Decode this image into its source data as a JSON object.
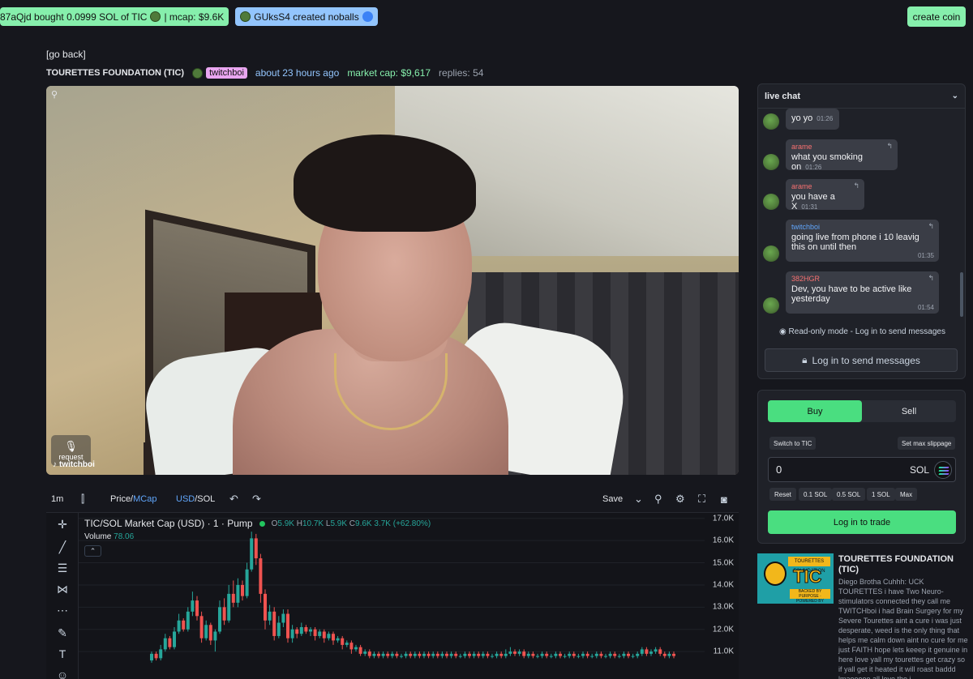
{
  "ticker": {
    "trade_text": "87aQjd bought 0.0999 SOL of TIC",
    "trade_mcap": "| mcap: $9.6K",
    "created_text": "GUksS4 created noballs",
    "create_coin": "create coin"
  },
  "header": {
    "go_back": "[go back]",
    "coin_name": "TOURETTES FOUNDATION (TIC)",
    "creator": "twitchboi",
    "age": "about 23 hours ago",
    "market_cap": "market cap: $9,617",
    "replies": "replies: 54"
  },
  "video": {
    "request_label": "request",
    "streamer": "twitchboi"
  },
  "chart_toolbar": {
    "interval": "1m",
    "price_label": "Price/",
    "mcap_label": "MCap",
    "usd_label": "USD",
    "sol_label": "/SOL",
    "save": "Save"
  },
  "chart_data": {
    "type": "candlestick",
    "title": "TIC/SOL Market Cap (USD) · 1 · Pump",
    "ohlc": {
      "o": "5.9K",
      "h": "10.7K",
      "l": "5.9K",
      "c": "9.6K",
      "change": "3.7K (+62.80%)"
    },
    "volume_label": "Volume",
    "volume_value": "78.06",
    "y_ticks": [
      "17.0K",
      "16.0K",
      "15.0K",
      "14.0K",
      "13.0K",
      "12.0K",
      "11.0K"
    ],
    "ylim": [
      10700,
      17100
    ],
    "colors": {
      "up": "#26a69a",
      "down": "#ef5350"
    },
    "candles": [
      {
        "o": 10.6,
        "c": 10.9,
        "h": 11.0,
        "l": 10.5
      },
      {
        "o": 10.9,
        "c": 10.7,
        "h": 11.0,
        "l": 10.6
      },
      {
        "o": 10.7,
        "c": 11.1,
        "h": 11.3,
        "l": 10.6
      },
      {
        "o": 11.1,
        "c": 11.6,
        "h": 11.8,
        "l": 11.0
      },
      {
        "o": 11.6,
        "c": 11.2,
        "h": 11.7,
        "l": 11.1
      },
      {
        "o": 11.2,
        "c": 11.9,
        "h": 12.1,
        "l": 11.1
      },
      {
        "o": 11.9,
        "c": 12.4,
        "h": 12.7,
        "l": 11.8
      },
      {
        "o": 12.4,
        "c": 12.0,
        "h": 12.5,
        "l": 11.9
      },
      {
        "o": 12.0,
        "c": 12.8,
        "h": 13.0,
        "l": 11.9
      },
      {
        "o": 12.8,
        "c": 13.3,
        "h": 13.7,
        "l": 12.6
      },
      {
        "o": 13.3,
        "c": 12.6,
        "h": 13.5,
        "l": 12.4
      },
      {
        "o": 12.6,
        "c": 11.6,
        "h": 12.8,
        "l": 11.4
      },
      {
        "o": 11.6,
        "c": 12.2,
        "h": 12.4,
        "l": 11.5
      },
      {
        "o": 12.2,
        "c": 11.5,
        "h": 12.3,
        "l": 11.3
      },
      {
        "o": 11.5,
        "c": 11.9,
        "h": 12.0,
        "l": 11.0
      },
      {
        "o": 11.9,
        "c": 13.0,
        "h": 13.3,
        "l": 11.8
      },
      {
        "o": 13.0,
        "c": 12.4,
        "h": 13.4,
        "l": 12.2
      },
      {
        "o": 12.4,
        "c": 13.6,
        "h": 14.0,
        "l": 12.3
      },
      {
        "o": 13.6,
        "c": 13.2,
        "h": 14.2,
        "l": 13.0
      },
      {
        "o": 13.2,
        "c": 14.0,
        "h": 14.3,
        "l": 13.0
      },
      {
        "o": 14.0,
        "c": 13.5,
        "h": 14.2,
        "l": 13.3
      },
      {
        "o": 13.5,
        "c": 14.7,
        "h": 15.0,
        "l": 13.4
      },
      {
        "o": 14.7,
        "c": 16.1,
        "h": 16.4,
        "l": 14.6
      },
      {
        "o": 16.1,
        "c": 15.2,
        "h": 16.3,
        "l": 14.9
      },
      {
        "o": 15.2,
        "c": 13.6,
        "h": 15.4,
        "l": 13.2
      },
      {
        "o": 13.6,
        "c": 12.4,
        "h": 13.8,
        "l": 12.0
      },
      {
        "o": 12.4,
        "c": 12.8,
        "h": 13.1,
        "l": 12.2
      },
      {
        "o": 12.8,
        "c": 11.7,
        "h": 13.0,
        "l": 11.5
      },
      {
        "o": 11.7,
        "c": 12.3,
        "h": 12.6,
        "l": 11.6
      },
      {
        "o": 12.3,
        "c": 12.7,
        "h": 12.9,
        "l": 12.1
      },
      {
        "o": 12.7,
        "c": 11.6,
        "h": 12.9,
        "l": 11.4
      },
      {
        "o": 11.6,
        "c": 12.0,
        "h": 12.2,
        "l": 11.4
      },
      {
        "o": 12.0,
        "c": 11.8,
        "h": 12.1,
        "l": 11.6
      },
      {
        "o": 11.8,
        "c": 12.1,
        "h": 12.3,
        "l": 11.7
      },
      {
        "o": 12.1,
        "c": 11.9,
        "h": 12.2,
        "l": 11.8
      },
      {
        "o": 11.9,
        "c": 12.0,
        "h": 12.1,
        "l": 11.7
      },
      {
        "o": 12.0,
        "c": 11.7,
        "h": 12.1,
        "l": 11.5
      },
      {
        "o": 11.7,
        "c": 11.9,
        "h": 12.0,
        "l": 11.6
      },
      {
        "o": 11.9,
        "c": 11.6,
        "h": 12.0,
        "l": 11.4
      },
      {
        "o": 11.6,
        "c": 11.8,
        "h": 11.9,
        "l": 11.5
      },
      {
        "o": 11.8,
        "c": 11.5,
        "h": 11.9,
        "l": 11.3
      },
      {
        "o": 11.5,
        "c": 11.6,
        "h": 11.7,
        "l": 11.4
      },
      {
        "o": 11.6,
        "c": 11.3,
        "h": 11.7,
        "l": 11.1
      },
      {
        "o": 11.3,
        "c": 11.4,
        "h": 11.5,
        "l": 11.2
      },
      {
        "o": 11.4,
        "c": 11.1,
        "h": 11.5,
        "l": 10.9
      },
      {
        "o": 11.1,
        "c": 11.2,
        "h": 11.3,
        "l": 11.0
      },
      {
        "o": 11.2,
        "c": 10.9,
        "h": 11.3,
        "l": 10.8
      },
      {
        "o": 10.9,
        "c": 11.0,
        "h": 11.1,
        "l": 10.8
      },
      {
        "o": 11.0,
        "c": 10.8,
        "h": 11.1,
        "l": 10.7
      },
      {
        "o": 10.8,
        "c": 10.9,
        "h": 11.0,
        "l": 10.7
      },
      {
        "o": 10.9,
        "c": 10.8,
        "h": 11.0,
        "l": 10.7
      },
      {
        "o": 10.8,
        "c": 10.9,
        "h": 11.0,
        "l": 10.7
      },
      {
        "o": 10.9,
        "c": 10.8,
        "h": 11.0,
        "l": 10.7
      },
      {
        "o": 10.8,
        "c": 10.9,
        "h": 11.0,
        "l": 10.7
      },
      {
        "o": 10.9,
        "c": 10.8,
        "h": 11.0,
        "l": 10.7
      },
      {
        "o": 10.8,
        "c": 10.8,
        "h": 10.9,
        "l": 10.7
      },
      {
        "o": 10.8,
        "c": 10.9,
        "h": 11.0,
        "l": 10.7
      },
      {
        "o": 10.9,
        "c": 10.8,
        "h": 11.0,
        "l": 10.7
      },
      {
        "o": 10.8,
        "c": 10.9,
        "h": 11.0,
        "l": 10.7
      },
      {
        "o": 10.9,
        "c": 10.8,
        "h": 11.0,
        "l": 10.7
      },
      {
        "o": 10.8,
        "c": 10.9,
        "h": 11.0,
        "l": 10.7
      },
      {
        "o": 10.9,
        "c": 10.8,
        "h": 11.0,
        "l": 10.7
      },
      {
        "o": 10.8,
        "c": 10.9,
        "h": 11.0,
        "l": 10.7
      },
      {
        "o": 10.9,
        "c": 10.8,
        "h": 11.0,
        "l": 10.7
      },
      {
        "o": 10.8,
        "c": 10.9,
        "h": 11.0,
        "l": 10.7
      },
      {
        "o": 10.9,
        "c": 10.8,
        "h": 11.0,
        "l": 10.7
      },
      {
        "o": 10.8,
        "c": 10.9,
        "h": 11.0,
        "l": 10.7
      },
      {
        "o": 10.9,
        "c": 10.8,
        "h": 11.0,
        "l": 10.7
      },
      {
        "o": 10.8,
        "c": 10.8,
        "h": 10.9,
        "l": 10.7
      },
      {
        "o": 10.8,
        "c": 10.9,
        "h": 11.0,
        "l": 10.7
      },
      {
        "o": 10.9,
        "c": 10.8,
        "h": 11.0,
        "l": 10.7
      },
      {
        "o": 10.8,
        "c": 10.9,
        "h": 11.0,
        "l": 10.7
      },
      {
        "o": 10.9,
        "c": 10.8,
        "h": 11.0,
        "l": 10.7
      },
      {
        "o": 10.8,
        "c": 10.9,
        "h": 11.0,
        "l": 10.7
      },
      {
        "o": 10.9,
        "c": 10.8,
        "h": 11.0,
        "l": 10.7
      },
      {
        "o": 10.8,
        "c": 10.8,
        "h": 10.9,
        "l": 10.7
      },
      {
        "o": 10.8,
        "c": 10.9,
        "h": 11.0,
        "l": 10.7
      },
      {
        "o": 10.9,
        "c": 10.8,
        "h": 11.0,
        "l": 10.7
      },
      {
        "o": 10.8,
        "c": 10.9,
        "h": 11.1,
        "l": 10.7
      },
      {
        "o": 10.9,
        "c": 11.0,
        "h": 11.2,
        "l": 10.8
      },
      {
        "o": 11.0,
        "c": 10.9,
        "h": 11.1,
        "l": 10.8
      },
      {
        "o": 10.9,
        "c": 11.0,
        "h": 11.1,
        "l": 10.8
      },
      {
        "o": 11.0,
        "c": 10.8,
        "h": 11.1,
        "l": 10.7
      },
      {
        "o": 10.8,
        "c": 10.9,
        "h": 11.0,
        "l": 10.7
      },
      {
        "o": 10.9,
        "c": 10.8,
        "h": 11.0,
        "l": 10.7
      },
      {
        "o": 10.8,
        "c": 10.8,
        "h": 10.9,
        "l": 10.7
      },
      {
        "o": 10.8,
        "c": 10.9,
        "h": 11.0,
        "l": 10.7
      },
      {
        "o": 10.9,
        "c": 10.8,
        "h": 11.0,
        "l": 10.7
      },
      {
        "o": 10.8,
        "c": 10.8,
        "h": 10.9,
        "l": 10.7
      },
      {
        "o": 10.8,
        "c": 10.9,
        "h": 11.0,
        "l": 10.7
      },
      {
        "o": 10.9,
        "c": 10.8,
        "h": 11.0,
        "l": 10.7
      },
      {
        "o": 10.8,
        "c": 10.8,
        "h": 10.9,
        "l": 10.7
      },
      {
        "o": 10.8,
        "c": 10.9,
        "h": 11.0,
        "l": 10.7
      },
      {
        "o": 10.9,
        "c": 10.8,
        "h": 11.0,
        "l": 10.7
      },
      {
        "o": 10.8,
        "c": 10.8,
        "h": 10.9,
        "l": 10.7
      },
      {
        "o": 10.8,
        "c": 10.9,
        "h": 11.0,
        "l": 10.7
      },
      {
        "o": 10.9,
        "c": 10.8,
        "h": 11.0,
        "l": 10.7
      },
      {
        "o": 10.8,
        "c": 10.8,
        "h": 10.9,
        "l": 10.7
      },
      {
        "o": 10.8,
        "c": 10.9,
        "h": 11.0,
        "l": 10.7
      },
      {
        "o": 10.9,
        "c": 10.8,
        "h": 11.0,
        "l": 10.7
      },
      {
        "o": 10.8,
        "c": 10.8,
        "h": 10.9,
        "l": 10.7
      },
      {
        "o": 10.8,
        "c": 10.9,
        "h": 11.0,
        "l": 10.7
      },
      {
        "o": 10.9,
        "c": 10.8,
        "h": 11.0,
        "l": 10.7
      },
      {
        "o": 10.8,
        "c": 10.8,
        "h": 10.9,
        "l": 10.7
      },
      {
        "o": 10.8,
        "c": 10.9,
        "h": 11.0,
        "l": 10.7
      },
      {
        "o": 10.9,
        "c": 10.8,
        "h": 11.0,
        "l": 10.7
      },
      {
        "o": 10.8,
        "c": 10.8,
        "h": 10.9,
        "l": 10.7
      },
      {
        "o": 10.8,
        "c": 10.9,
        "h": 11.0,
        "l": 10.7
      },
      {
        "o": 10.9,
        "c": 11.1,
        "h": 11.2,
        "l": 10.8
      },
      {
        "o": 11.1,
        "c": 10.9,
        "h": 11.2,
        "l": 10.8
      },
      {
        "o": 10.9,
        "c": 11.0,
        "h": 11.1,
        "l": 10.8
      },
      {
        "o": 11.0,
        "c": 11.1,
        "h": 11.2,
        "l": 10.9
      },
      {
        "o": 11.1,
        "c": 10.9,
        "h": 11.2,
        "l": 10.8
      },
      {
        "o": 10.9,
        "c": 10.8,
        "h": 11.0,
        "l": 10.7
      },
      {
        "o": 10.8,
        "c": 10.9,
        "h": 11.0,
        "l": 10.7
      },
      {
        "o": 10.9,
        "c": 10.8,
        "h": 11.0,
        "l": 10.7
      }
    ]
  },
  "chat": {
    "title": "live chat",
    "messages": [
      {
        "user": "",
        "text": "yo yo",
        "time": "01:26"
      },
      {
        "user": "arame",
        "text": "what you smoking on",
        "time": "01:26"
      },
      {
        "user": "arame",
        "text": "you have a X",
        "time": "01:31"
      },
      {
        "user": "twitchboi",
        "text1": "going live from phone i 10 leavig",
        "text2": "this on until then",
        "time": "01:35"
      },
      {
        "user": "382HGR",
        "text1": "Dev, you have to be active like",
        "text2": "yesterday",
        "time": "01:54"
      }
    ],
    "readonly": "Read-only mode - Log in to send messages",
    "login_send": "Log in to send messages",
    "colors": {
      "arame": "#f87171",
      "twitchboi": "#60a5fa",
      "382HGR": "#f87171"
    }
  },
  "trade": {
    "buy": "Buy",
    "sell": "Sell",
    "switch": "Switch to TIC",
    "slippage": "Set max slippage",
    "amount": "0",
    "currency": "SOL",
    "quick": [
      "Reset",
      "0.1 SOL",
      "0.5 SOL",
      "1 SOL",
      "Max"
    ],
    "login_trade": "Log in to trade"
  },
  "coin_info": {
    "name": "TOURETTES FOUNDATION (TIC)",
    "image_banner": "TOURETTES FOUNDATION",
    "image_big": "TIC",
    "image_sub": "BACKED BY PURPOSE · POWERED BY COMMUNITY",
    "description": "Diego Brotha Cuhhh: UCK TOURETTES i have Two Neuro-stimulators connected they call me TWITCHboi i had Brain Surgery for my Severe Tourettes aint a cure i was just desperate, weed is the only thing that helps me calm down aint no cure for me just FAITH hope lets keeep it genuine in here love yall my tourettes get crazy so if yall get it heated it will roast baddd lmaooooo all love tho i"
  }
}
